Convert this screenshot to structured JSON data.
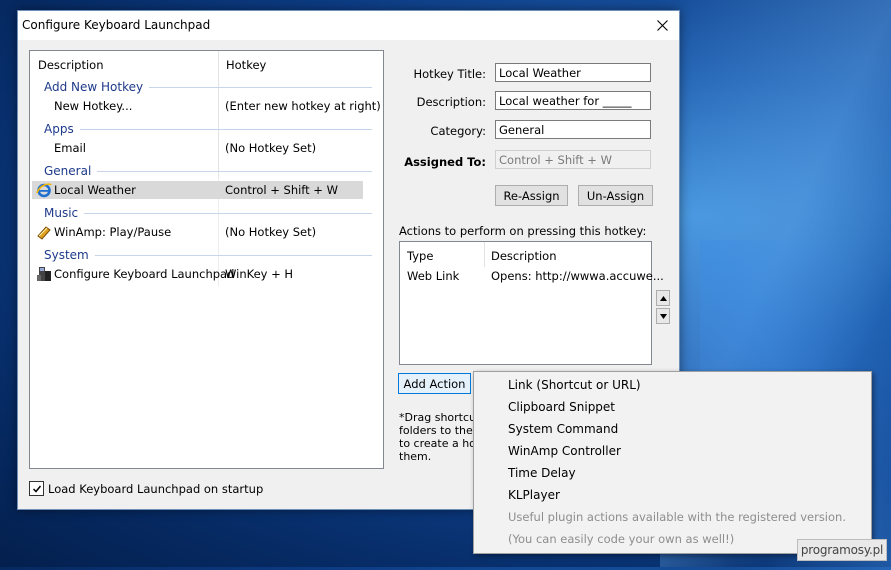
{
  "window": {
    "title": "Configure Keyboard Launchpad"
  },
  "hotkey_list": {
    "columns": [
      "Description",
      "Hotkey"
    ],
    "groups": [
      {
        "name": "Add New Hotkey",
        "items": [
          {
            "name": "New Hotkey...",
            "hotkey": "(Enter new hotkey at right)",
            "icon": "none"
          }
        ]
      },
      {
        "name": "Apps",
        "items": [
          {
            "name": "Email",
            "hotkey": "(No Hotkey Set)",
            "icon": "none"
          }
        ]
      },
      {
        "name": "General",
        "items": [
          {
            "name": "Local Weather",
            "hotkey": "Control + Shift + W",
            "icon": "internet-explorer-icon",
            "selected": true
          }
        ]
      },
      {
        "name": "Music",
        "items": [
          {
            "name": "WinAmp: Play/Pause",
            "hotkey": "(No Hotkey Set)",
            "icon": "winamp-icon"
          }
        ]
      },
      {
        "name": "System",
        "items": [
          {
            "name": "Configure Keyboard Launchpad",
            "hotkey": "WinKey + H",
            "icon": "keyboard-launchpad-icon"
          }
        ]
      }
    ]
  },
  "startup_checkbox": {
    "label": "Load Keyboard Launchpad on startup",
    "checked": true
  },
  "form": {
    "hotkey_title_label": "Hotkey Title:",
    "hotkey_title_value": "Local Weather",
    "description_label": "Description:",
    "description_value": "Local weather for _____",
    "category_label": "Category:",
    "category_value": "General",
    "assigned_to_label": "Assigned To:",
    "assigned_to_value": "Control + Shift + W",
    "reassign_label": "Re-Assign",
    "unassign_label": "Un-Assign"
  },
  "actions": {
    "label": "Actions to perform on pressing this hotkey:",
    "columns": [
      "Type",
      "Description"
    ],
    "rows": [
      {
        "type": "Web Link",
        "description": "Opens: http://wwwa.accuwe..."
      }
    ],
    "add_action_label": "Add Action"
  },
  "note": {
    "lines": [
      "*Drag shortcuts,",
      "folders to the ma",
      "to create a hotk",
      "them."
    ]
  },
  "popup_menu": {
    "items": [
      "Link (Shortcut or URL)",
      "Clipboard Snippet",
      "System Command",
      "WinAmp Controller",
      "Time Delay",
      "KLPlayer"
    ],
    "disabled_items": [
      "Useful plugin actions available with the registered version.",
      "(You can easily code your own as well!)"
    ]
  },
  "watermark": {
    "text": "programosy.pl"
  }
}
